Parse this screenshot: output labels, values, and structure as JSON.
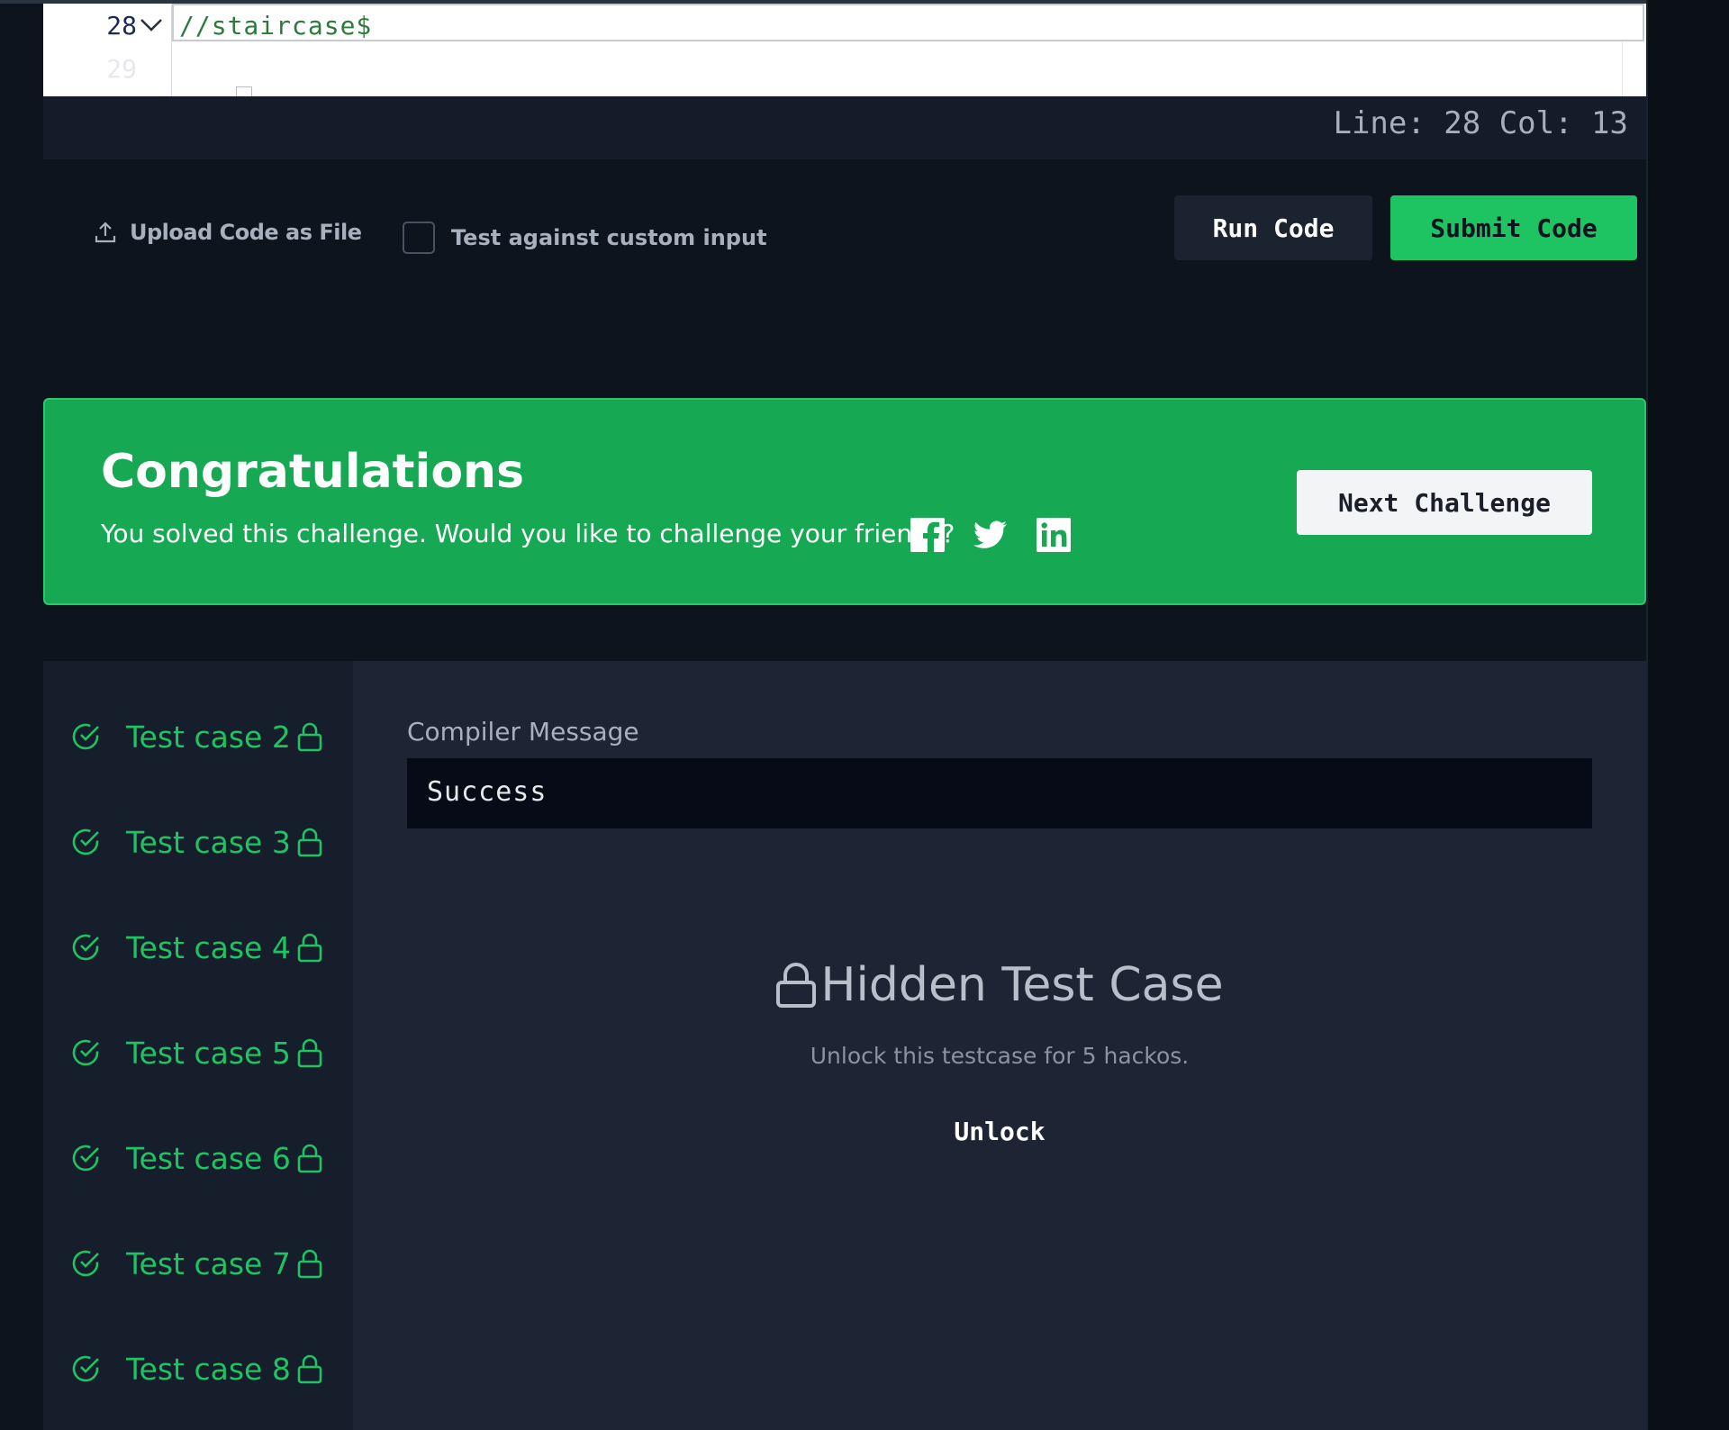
{
  "editor": {
    "line_number": "28",
    "next_line_number": "29",
    "code": "//staircase$"
  },
  "status": {
    "cursor_text": "Line: 28 Col: 13"
  },
  "actions": {
    "upload_label": "Upload Code as File",
    "custom_input_label": "Test against custom input",
    "run_label": "Run Code",
    "submit_label": "Submit Code"
  },
  "banner": {
    "title": "Congratulations",
    "subtitle": "You solved this challenge. Would you like to challenge your friends?",
    "next_label": "Next Challenge"
  },
  "tests": [
    {
      "label": "Test case 2"
    },
    {
      "label": "Test case 3"
    },
    {
      "label": "Test case 4"
    },
    {
      "label": "Test case 5"
    },
    {
      "label": "Test case 6"
    },
    {
      "label": "Test case 7"
    },
    {
      "label": "Test case 8"
    }
  ],
  "results": {
    "compiler_label": "Compiler Message",
    "compiler_message": "Success",
    "hidden_title": "Hidden Test Case",
    "hidden_sub": "Unlock this testcase for 5 hackos.",
    "unlock_label": "Unlock"
  },
  "colors": {
    "background": "#0e141e",
    "accent_green": "#1ec462",
    "banner_green": "#16a853"
  }
}
